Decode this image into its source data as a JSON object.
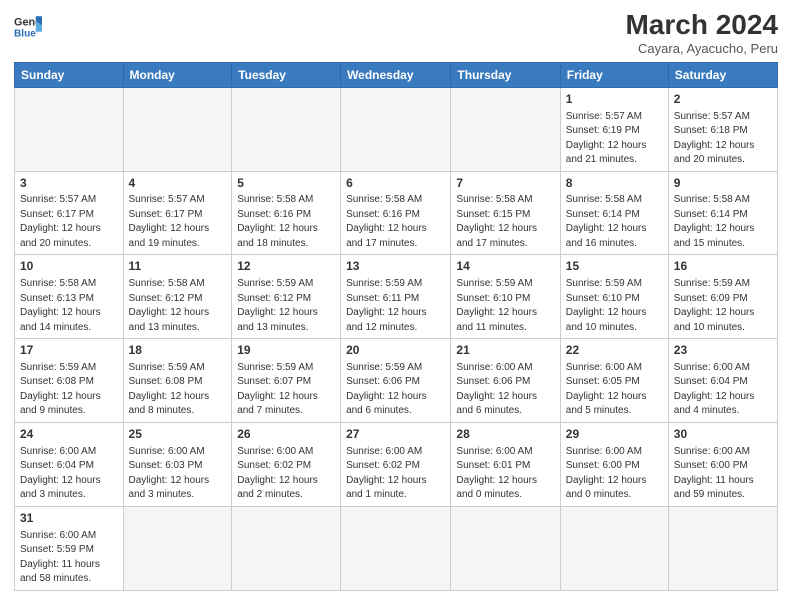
{
  "header": {
    "logo_general": "General",
    "logo_blue": "Blue",
    "month_year": "March 2024",
    "location": "Cayara, Ayacucho, Peru"
  },
  "days_of_week": [
    "Sunday",
    "Monday",
    "Tuesday",
    "Wednesday",
    "Thursday",
    "Friday",
    "Saturday"
  ],
  "weeks": [
    [
      {
        "day": null,
        "info": null
      },
      {
        "day": null,
        "info": null
      },
      {
        "day": null,
        "info": null
      },
      {
        "day": null,
        "info": null
      },
      {
        "day": null,
        "info": null
      },
      {
        "day": "1",
        "info": "Sunrise: 5:57 AM\nSunset: 6:19 PM\nDaylight: 12 hours and 21 minutes."
      },
      {
        "day": "2",
        "info": "Sunrise: 5:57 AM\nSunset: 6:18 PM\nDaylight: 12 hours and 20 minutes."
      }
    ],
    [
      {
        "day": "3",
        "info": "Sunrise: 5:57 AM\nSunset: 6:17 PM\nDaylight: 12 hours and 20 minutes."
      },
      {
        "day": "4",
        "info": "Sunrise: 5:57 AM\nSunset: 6:17 PM\nDaylight: 12 hours and 19 minutes."
      },
      {
        "day": "5",
        "info": "Sunrise: 5:58 AM\nSunset: 6:16 PM\nDaylight: 12 hours and 18 minutes."
      },
      {
        "day": "6",
        "info": "Sunrise: 5:58 AM\nSunset: 6:16 PM\nDaylight: 12 hours and 17 minutes."
      },
      {
        "day": "7",
        "info": "Sunrise: 5:58 AM\nSunset: 6:15 PM\nDaylight: 12 hours and 17 minutes."
      },
      {
        "day": "8",
        "info": "Sunrise: 5:58 AM\nSunset: 6:14 PM\nDaylight: 12 hours and 16 minutes."
      },
      {
        "day": "9",
        "info": "Sunrise: 5:58 AM\nSunset: 6:14 PM\nDaylight: 12 hours and 15 minutes."
      }
    ],
    [
      {
        "day": "10",
        "info": "Sunrise: 5:58 AM\nSunset: 6:13 PM\nDaylight: 12 hours and 14 minutes."
      },
      {
        "day": "11",
        "info": "Sunrise: 5:58 AM\nSunset: 6:12 PM\nDaylight: 12 hours and 13 minutes."
      },
      {
        "day": "12",
        "info": "Sunrise: 5:59 AM\nSunset: 6:12 PM\nDaylight: 12 hours and 13 minutes."
      },
      {
        "day": "13",
        "info": "Sunrise: 5:59 AM\nSunset: 6:11 PM\nDaylight: 12 hours and 12 minutes."
      },
      {
        "day": "14",
        "info": "Sunrise: 5:59 AM\nSunset: 6:10 PM\nDaylight: 12 hours and 11 minutes."
      },
      {
        "day": "15",
        "info": "Sunrise: 5:59 AM\nSunset: 6:10 PM\nDaylight: 12 hours and 10 minutes."
      },
      {
        "day": "16",
        "info": "Sunrise: 5:59 AM\nSunset: 6:09 PM\nDaylight: 12 hours and 10 minutes."
      }
    ],
    [
      {
        "day": "17",
        "info": "Sunrise: 5:59 AM\nSunset: 6:08 PM\nDaylight: 12 hours and 9 minutes."
      },
      {
        "day": "18",
        "info": "Sunrise: 5:59 AM\nSunset: 6:08 PM\nDaylight: 12 hours and 8 minutes."
      },
      {
        "day": "19",
        "info": "Sunrise: 5:59 AM\nSunset: 6:07 PM\nDaylight: 12 hours and 7 minutes."
      },
      {
        "day": "20",
        "info": "Sunrise: 5:59 AM\nSunset: 6:06 PM\nDaylight: 12 hours and 6 minutes."
      },
      {
        "day": "21",
        "info": "Sunrise: 6:00 AM\nSunset: 6:06 PM\nDaylight: 12 hours and 6 minutes."
      },
      {
        "day": "22",
        "info": "Sunrise: 6:00 AM\nSunset: 6:05 PM\nDaylight: 12 hours and 5 minutes."
      },
      {
        "day": "23",
        "info": "Sunrise: 6:00 AM\nSunset: 6:04 PM\nDaylight: 12 hours and 4 minutes."
      }
    ],
    [
      {
        "day": "24",
        "info": "Sunrise: 6:00 AM\nSunset: 6:04 PM\nDaylight: 12 hours and 3 minutes."
      },
      {
        "day": "25",
        "info": "Sunrise: 6:00 AM\nSunset: 6:03 PM\nDaylight: 12 hours and 3 minutes."
      },
      {
        "day": "26",
        "info": "Sunrise: 6:00 AM\nSunset: 6:02 PM\nDaylight: 12 hours and 2 minutes."
      },
      {
        "day": "27",
        "info": "Sunrise: 6:00 AM\nSunset: 6:02 PM\nDaylight: 12 hours and 1 minute."
      },
      {
        "day": "28",
        "info": "Sunrise: 6:00 AM\nSunset: 6:01 PM\nDaylight: 12 hours and 0 minutes."
      },
      {
        "day": "29",
        "info": "Sunrise: 6:00 AM\nSunset: 6:00 PM\nDaylight: 12 hours and 0 minutes."
      },
      {
        "day": "30",
        "info": "Sunrise: 6:00 AM\nSunset: 6:00 PM\nDaylight: 11 hours and 59 minutes."
      }
    ],
    [
      {
        "day": "31",
        "info": "Sunrise: 6:00 AM\nSunset: 5:59 PM\nDaylight: 11 hours and 58 minutes."
      },
      {
        "day": null,
        "info": null
      },
      {
        "day": null,
        "info": null
      },
      {
        "day": null,
        "info": null
      },
      {
        "day": null,
        "info": null
      },
      {
        "day": null,
        "info": null
      },
      {
        "day": null,
        "info": null
      }
    ]
  ]
}
